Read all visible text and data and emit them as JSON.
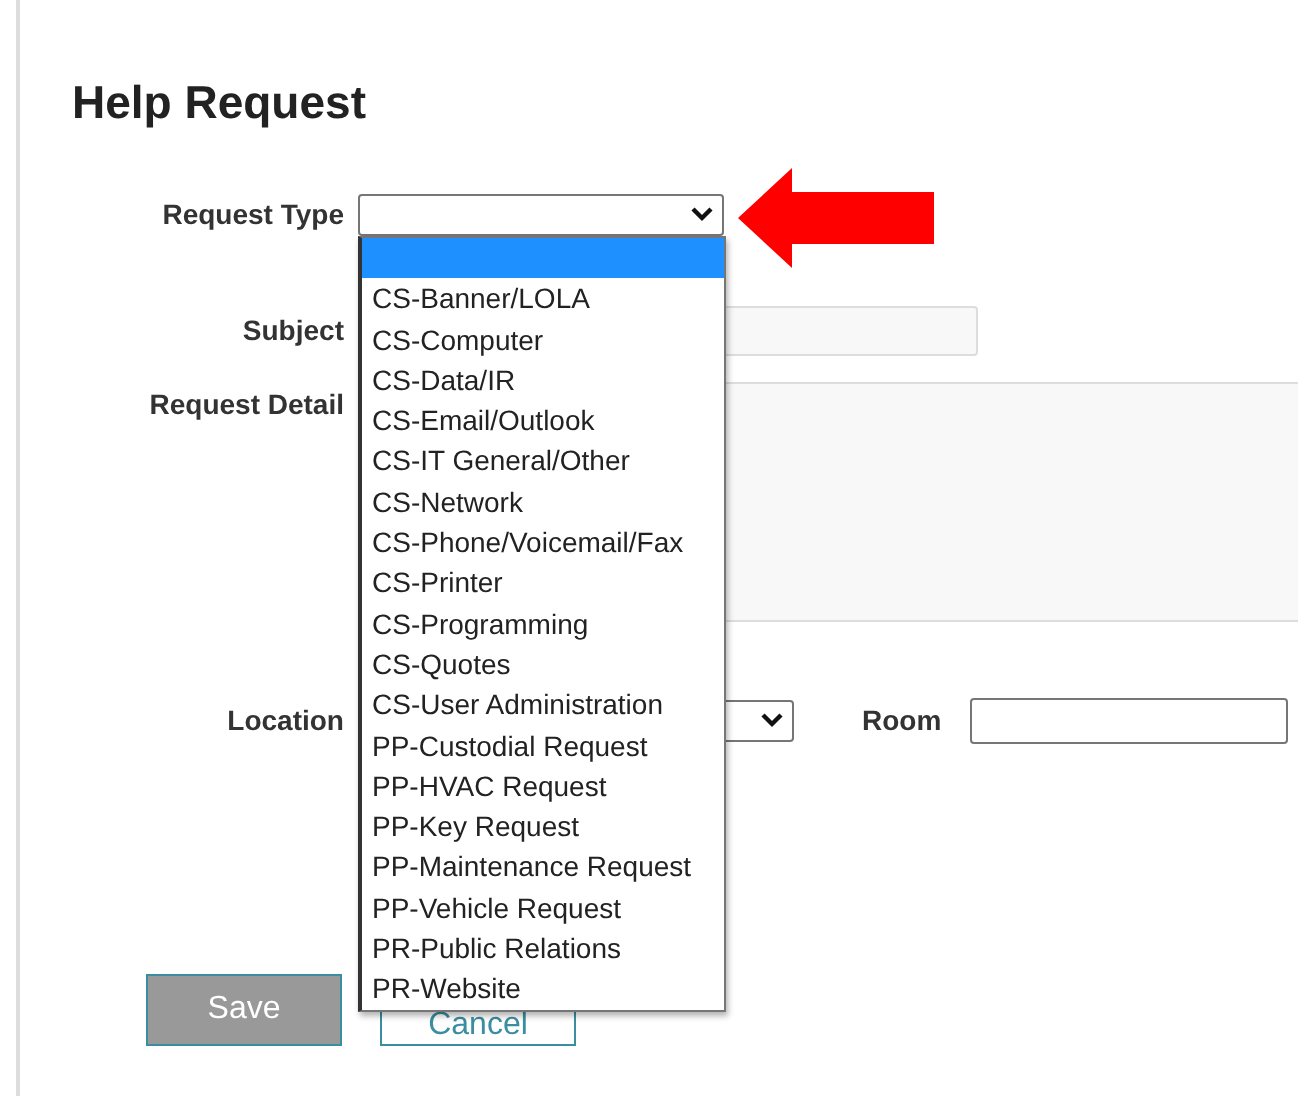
{
  "title": "Help Request",
  "request_type": {
    "label": "Request Type",
    "expanded": true,
    "options": [
      {
        "selected": true
      },
      {
        "label": "CS-Banner/LOLA",
        "selected": false
      },
      {
        "label": "CS-Computer",
        "selected": false
      },
      {
        "label": "CS-Data/IR",
        "selected": false
      },
      {
        "label": "CS-Email/Outlook",
        "selected": false
      },
      {
        "label": "CS-IT General/Other",
        "selected": false
      },
      {
        "label": "CS-Network",
        "selected": false
      },
      {
        "label": "CS-Phone/Voicemail/Fax",
        "selected": false
      },
      {
        "label": "CS-Printer",
        "selected": false
      },
      {
        "label": "CS-Programming",
        "selected": false
      },
      {
        "label": "CS-Quotes",
        "selected": false
      },
      {
        "label": "CS-User Administration",
        "selected": false
      },
      {
        "label": "PP-Custodial Request",
        "selected": false
      },
      {
        "label": "PP-HVAC Request",
        "selected": false
      },
      {
        "label": "PP-Key Request",
        "selected": false
      },
      {
        "label": "PP-Maintenance Request",
        "selected": false
      },
      {
        "label": "PP-Vehicle Request",
        "selected": false
      },
      {
        "label": "PR-Public Relations",
        "selected": false
      },
      {
        "label": "PR-Website",
        "selected": false
      }
    ]
  },
  "subject": {
    "label": "Subject"
  },
  "request_detail": {
    "label": "Request Detail"
  },
  "location": {
    "label": "Location"
  },
  "room": {
    "label": "Room"
  },
  "buttons": [
    {
      "label": "Save",
      "kind": "primary"
    },
    {
      "label": "Cancel",
      "kind": "secondary"
    }
  ]
}
